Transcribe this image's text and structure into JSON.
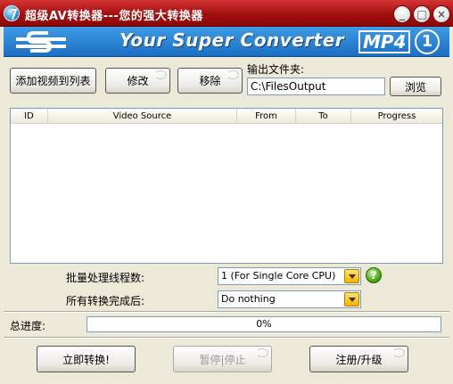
{
  "window": {
    "title": "超级AV转换器---您的强大转换器"
  },
  "titlebar_buttons": {
    "minimize": "_",
    "maximize": "□",
    "close": "×"
  },
  "banner": {
    "title": "Your Super Converter",
    "format_badge": "MP4",
    "number_badge": "1"
  },
  "toolbar": {
    "add_label": "添加视频到列表",
    "edit_label": "修改",
    "remove_label": "移除",
    "output_label": "输出文件夹:",
    "output_path": "C:\\FilesOutput",
    "browse_label": "浏览"
  },
  "table": {
    "columns": [
      "ID",
      "Video Source",
      "From",
      "To",
      "Progress"
    ]
  },
  "settings": {
    "threads_label": "批量处理线程数:",
    "threads_value": "1 (For Single Core CPU)",
    "after_label": "所有转换完成后:",
    "after_value": "Do nothing",
    "help_icon_text": "?"
  },
  "progress": {
    "label": "总进度:",
    "value_text": "0%",
    "value": 0
  },
  "actions": {
    "convert_label": "立即转换!",
    "pause_label": "暂停|停止",
    "register_label": "注册/升级"
  },
  "colors": {
    "titlebar": "#b31a1a",
    "banner": "#2a82d4"
  }
}
